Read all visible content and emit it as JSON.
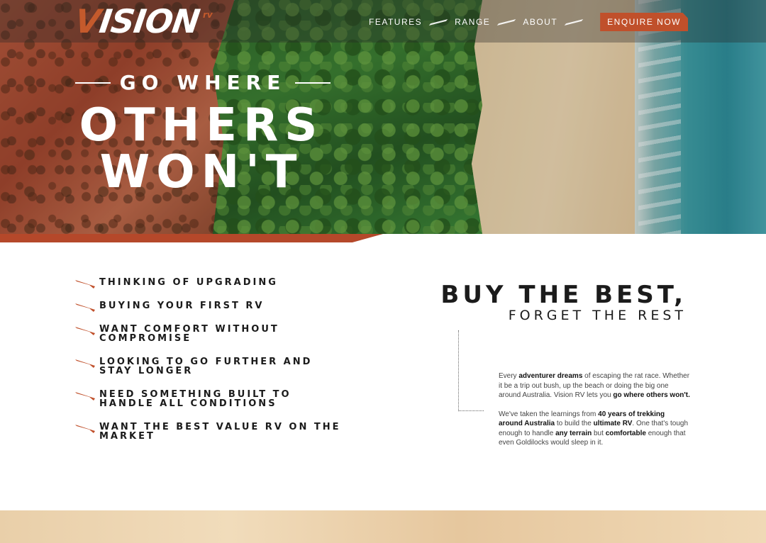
{
  "logo": {
    "word": "ISION",
    "v_letter": "V",
    "suffix": "rv"
  },
  "nav": {
    "links": [
      {
        "label": "FEATURES"
      },
      {
        "label": "RANGE"
      },
      {
        "label": "ABOUT"
      }
    ],
    "cta": "ENQUIRE NOW"
  },
  "hero": {
    "kicker": "GO WHERE",
    "headline_line1": "OTHERS",
    "headline_line2": "WON'T"
  },
  "reasons": [
    "THINKING OF UPGRADING",
    "BUYING YOUR FIRST RV",
    "WANT COMFORT WITHOUT COMPROMISE",
    "LOOKING TO GO FURTHER AND STAY LONGER",
    "NEED SOMETHING BUILT TO HANDLE ALL CONDITIONS",
    "WANT THE BEST VALUE RV ON THE MARKET"
  ],
  "buy": {
    "title": "BUY THE BEST,",
    "subtitle": "FORGET THE REST"
  },
  "copy": {
    "p1": [
      {
        "t": "Every ",
        "b": false
      },
      {
        "t": "adventurer dreams",
        "b": true
      },
      {
        "t": " of escaping the rat race. Whether it be a trip out bush, up the beach or doing the big one around Australia. Vision RV lets you ",
        "b": false
      },
      {
        "t": "go where others won't.",
        "b": true
      }
    ],
    "p2": [
      {
        "t": "We've taken the learnings from ",
        "b": false
      },
      {
        "t": "40 years of trekking around Australia",
        "b": true
      },
      {
        "t": " to build the ",
        "b": false
      },
      {
        "t": "ultimate RV",
        "b": true
      },
      {
        "t": ". One that's tough enough to handle ",
        "b": false
      },
      {
        "t": "any terrain",
        "b": true
      },
      {
        "t": " but ",
        "b": false
      },
      {
        "t": "comfortable",
        "b": true
      },
      {
        "t": " enough that even Goldilocks would sleep in it.",
        "b": false
      }
    ]
  },
  "colors": {
    "accent": "#c0502b",
    "text": "#1b1b1b"
  },
  "icons": {
    "reason_bullet": "slash-mark-icon",
    "nav_separator": "slash-separator-icon"
  }
}
